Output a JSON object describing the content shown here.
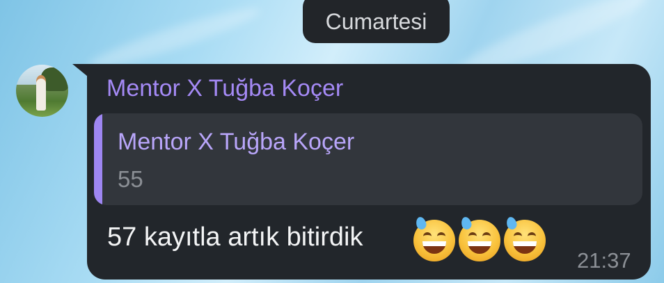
{
  "date_separator": {
    "label": "Cumartesi"
  },
  "message": {
    "sender": "Mentor X Tuğba Koçer",
    "reply": {
      "sender": "Mentor X Tuğba Koçer",
      "text": "55"
    },
    "text": "57 kayıtla artık bitirdik",
    "emojis": [
      "grinning-face-with-sweat-emoji",
      "grinning-face-with-sweat-emoji",
      "grinning-face-with-sweat-emoji"
    ],
    "time": "21:37"
  },
  "colors": {
    "bubble": "#22262b",
    "sender_name": "#a58af6",
    "reply_bar": "#9e86f2",
    "date_pill": "#222529"
  }
}
